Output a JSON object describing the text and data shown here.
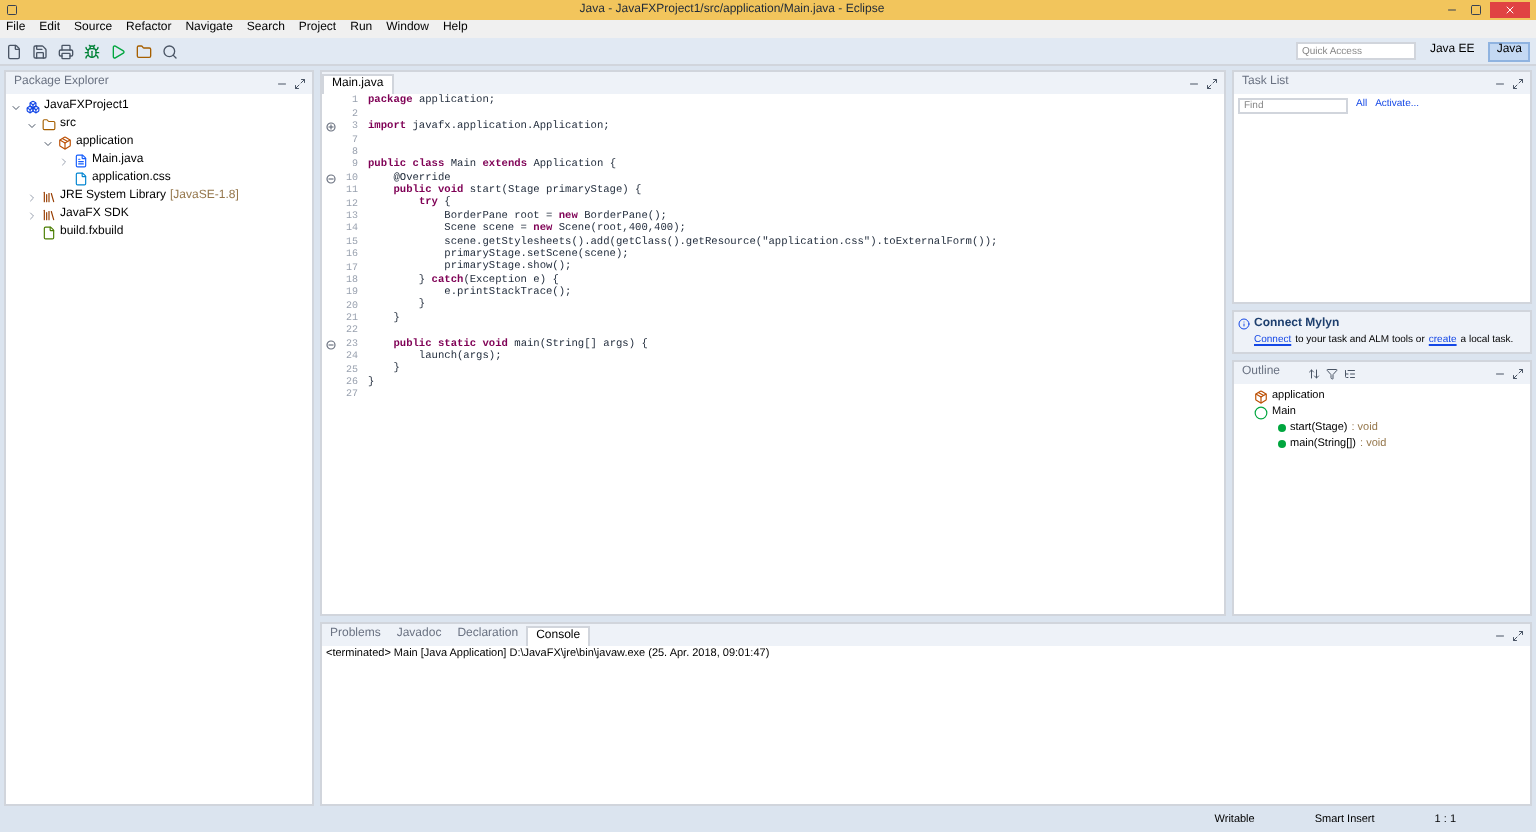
{
  "window": {
    "title": "Java - JavaFXProject1/src/application/Main.java - Eclipse"
  },
  "menu": [
    "File",
    "Edit",
    "Source",
    "Refactor",
    "Navigate",
    "Search",
    "Project",
    "Run",
    "Window",
    "Help"
  ],
  "toolbar": {
    "quick_access": {
      "placeholder": "Quick Access"
    },
    "perspectives": [
      {
        "label": "Java EE",
        "selected": false
      },
      {
        "label": "Java",
        "selected": true
      }
    ]
  },
  "package_explorer": {
    "title": "Package Explorer",
    "tree": [
      {
        "label": "JavaFXProject1",
        "kind": "project",
        "expanded": true,
        "children": [
          {
            "label": "src",
            "kind": "folder",
            "expanded": true,
            "children": [
              {
                "label": "application",
                "kind": "package",
                "expanded": true,
                "children": [
                  {
                    "label": "Main.java",
                    "kind": "java",
                    "expanded": false
                  },
                  {
                    "label": "application.css",
                    "kind": "css"
                  }
                ]
              }
            ]
          },
          {
            "label": "JRE System Library",
            "suffix": "[JavaSE-1.8]",
            "kind": "library",
            "expanded": false
          },
          {
            "label": "JavaFX SDK",
            "kind": "library",
            "expanded": false
          },
          {
            "label": "build.fxbuild",
            "kind": "file"
          }
        ]
      }
    ]
  },
  "editor": {
    "tab": "Main.java",
    "lines": [
      {
        "num": "1",
        "text": "**package** application;"
      },
      {
        "num": "2"
      },
      {
        "num": "3",
        "folded": true,
        "text": "**import** javafx.application.Application;"
      },
      {
        "num": "7"
      },
      {
        "num": "8"
      },
      {
        "num": "9",
        "text": "**public** **class** Main **extends** Application {"
      },
      {
        "num": "10",
        "folded": false,
        "text": "    @Override"
      },
      {
        "num": "11",
        "text": "    **public** **void** start(Stage primaryStage) {"
      },
      {
        "num": "12",
        "text": "        **try** {"
      },
      {
        "num": "13",
        "text": "            BorderPane root = **new** BorderPane();"
      },
      {
        "num": "14",
        "text": "            Scene scene = **new** Scene(root,400,400);"
      },
      {
        "num": "15",
        "text": "            scene.getStylesheets().add(getClass().getResource(\"application.css\").toExternalForm());"
      },
      {
        "num": "16",
        "text": "            primaryStage.setScene(scene);"
      },
      {
        "num": "17",
        "text": "            primaryStage.show();"
      },
      {
        "num": "18",
        "text": "        } **catch**(Exception e) {"
      },
      {
        "num": "19",
        "text": "            e.printStackTrace();"
      },
      {
        "num": "20",
        "text": "        }"
      },
      {
        "num": "21",
        "text": "    }"
      },
      {
        "num": "22"
      },
      {
        "num": "23",
        "folded": false,
        "text": "    **public** **static** **void** main(String[] args) {"
      },
      {
        "num": "24",
        "text": "        launch(args);"
      },
      {
        "num": "25",
        "text": "    }"
      },
      {
        "num": "26",
        "text": "}"
      },
      {
        "num": "27"
      }
    ]
  },
  "task_list": {
    "title": "Task List",
    "find": {
      "placeholder": "Find"
    },
    "all": "All",
    "activate": "Activate..."
  },
  "mylyn": {
    "title": "Connect Mylyn",
    "before": "to your task and ALM tools or",
    "connect": "Connect",
    "create": "create",
    "after": "a local task."
  },
  "outline": {
    "title": "Outline",
    "items": [
      {
        "label": "application",
        "kind": "package"
      },
      {
        "label": "Main",
        "kind": "class",
        "children": [
          {
            "label": "start(Stage)",
            "type": ": void",
            "kind": "method"
          },
          {
            "label": "main(String[])",
            "type": ": void",
            "kind": "method"
          }
        ]
      }
    ]
  },
  "bottom_tabs": [
    {
      "label": "Problems",
      "selected": false
    },
    {
      "label": "Javadoc",
      "selected": false
    },
    {
      "label": "Declaration",
      "selected": false
    },
    {
      "label": "Console",
      "selected": true
    }
  ],
  "console": {
    "text": "<terminated> Main [Java Application] D:\\JavaFX\\jre\\bin\\javaw.exe (25. Apr. 2018, 09:01:47)"
  },
  "status_bar": [
    "Writable",
    "Smart Insert",
    "1 : 1"
  ]
}
